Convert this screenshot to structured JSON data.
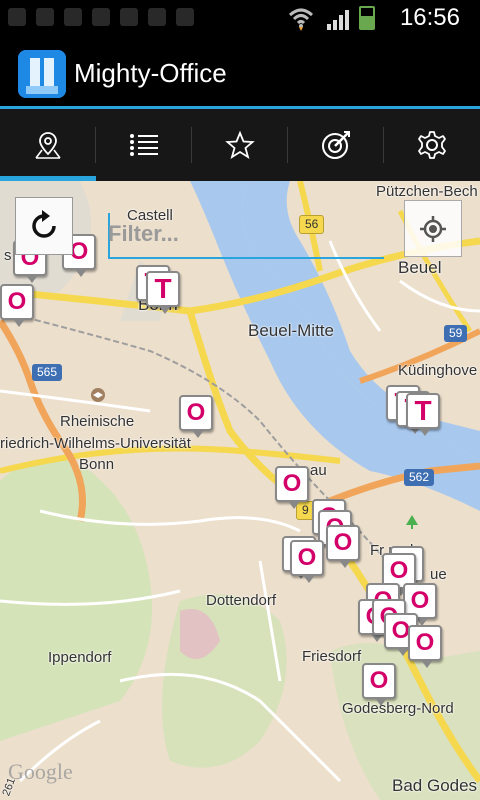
{
  "status_bar": {
    "time": "16:56",
    "icons": [
      "notification-icon",
      "gps-icon",
      "mail-icon",
      "sd-card-icon",
      "android-icon",
      "image-icon",
      "mute-icon",
      "wifi-icon",
      "signal-icon",
      "battery-icon"
    ]
  },
  "app": {
    "title": "Mighty-Office",
    "accent_color": "#2aa4dd"
  },
  "tabs": [
    {
      "name": "map",
      "icon": "map-pin-icon",
      "selected": true
    },
    {
      "name": "list",
      "icon": "list-icon",
      "selected": false
    },
    {
      "name": "favorites",
      "icon": "star-icon",
      "selected": false
    },
    {
      "name": "edit",
      "icon": "edit-target-icon",
      "selected": false
    },
    {
      "name": "settings",
      "icon": "gear-icon",
      "selected": false
    }
  ],
  "filter": {
    "placeholder": "Filter..."
  },
  "map": {
    "places": {
      "castell": "Castell",
      "putzchen": "Pützchen-Bech",
      "beuel": "Beuel",
      "bonn_top": "Bonn",
      "beuel_mitte": "Beuel-Mitte",
      "kudinghoven": "Küdinghove",
      "rheinische": "Rheinische",
      "uni": "riedrich-Wilhelms-Universität",
      "bonn_uni": "Bonn",
      "au": "au",
      "friesdorf_park": "Fr       park",
      "aue": "ue",
      "dottendorf": "Dottendorf",
      "ippendorf": "Ippendorf",
      "friesdorf": "Friesdorf",
      "godesberg_nord": "Godesberg-Nord",
      "bad_godes": "Bad Godes",
      "google": "Google",
      "s": "s",
      "road_num": "261"
    },
    "road_shields": {
      "r56": "56",
      "r59": "59",
      "r565": "565",
      "r562": "562",
      "r9": "9"
    },
    "marker_letters": {
      "office": "O",
      "telekom": "T"
    }
  }
}
